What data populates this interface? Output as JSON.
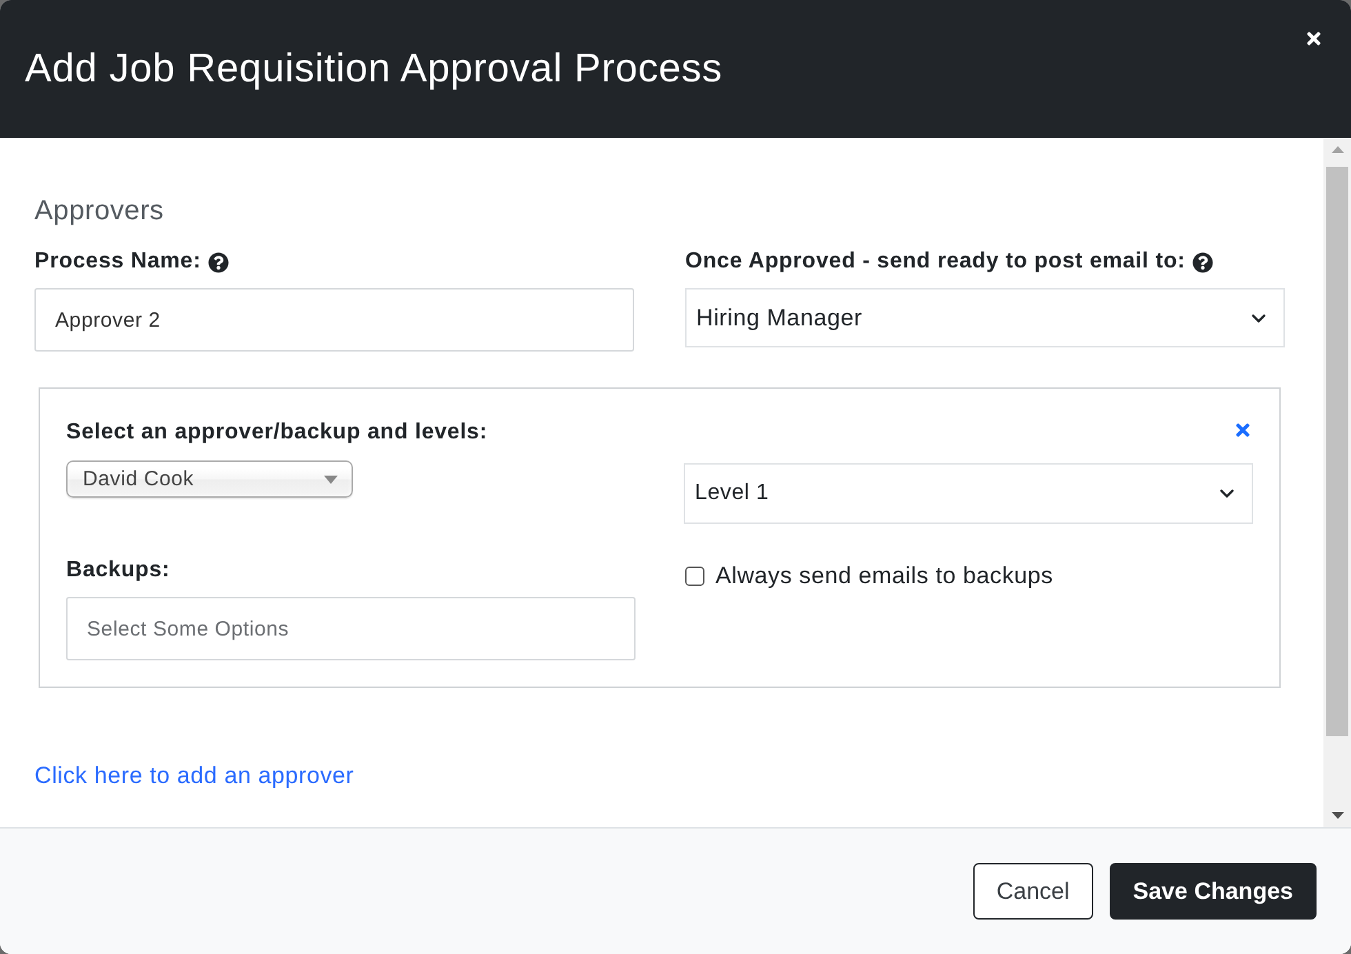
{
  "dialog": {
    "title": "Add Job Requisition Approval Process"
  },
  "section_heading": "Approvers",
  "process_name": {
    "label": "Process Name:",
    "value": "Approver 2"
  },
  "post_email": {
    "label": "Once Approved - send ready to post email to:",
    "value": "Hiring Manager"
  },
  "approvers": [
    {
      "label": "Select an approver/backup and levels:",
      "approver": "David Cook",
      "level": "Level 1",
      "backups": {
        "label": "Backups:",
        "placeholder": "Select Some Options"
      },
      "always_email": {
        "label": "Always send emails to backups",
        "checked": false
      }
    }
  ],
  "add_link": "Click here to add an approver",
  "buttons": [
    {
      "label": "Cancel",
      "kind": "secondary"
    },
    {
      "label": "Save Changes",
      "kind": "primary"
    }
  ]
}
